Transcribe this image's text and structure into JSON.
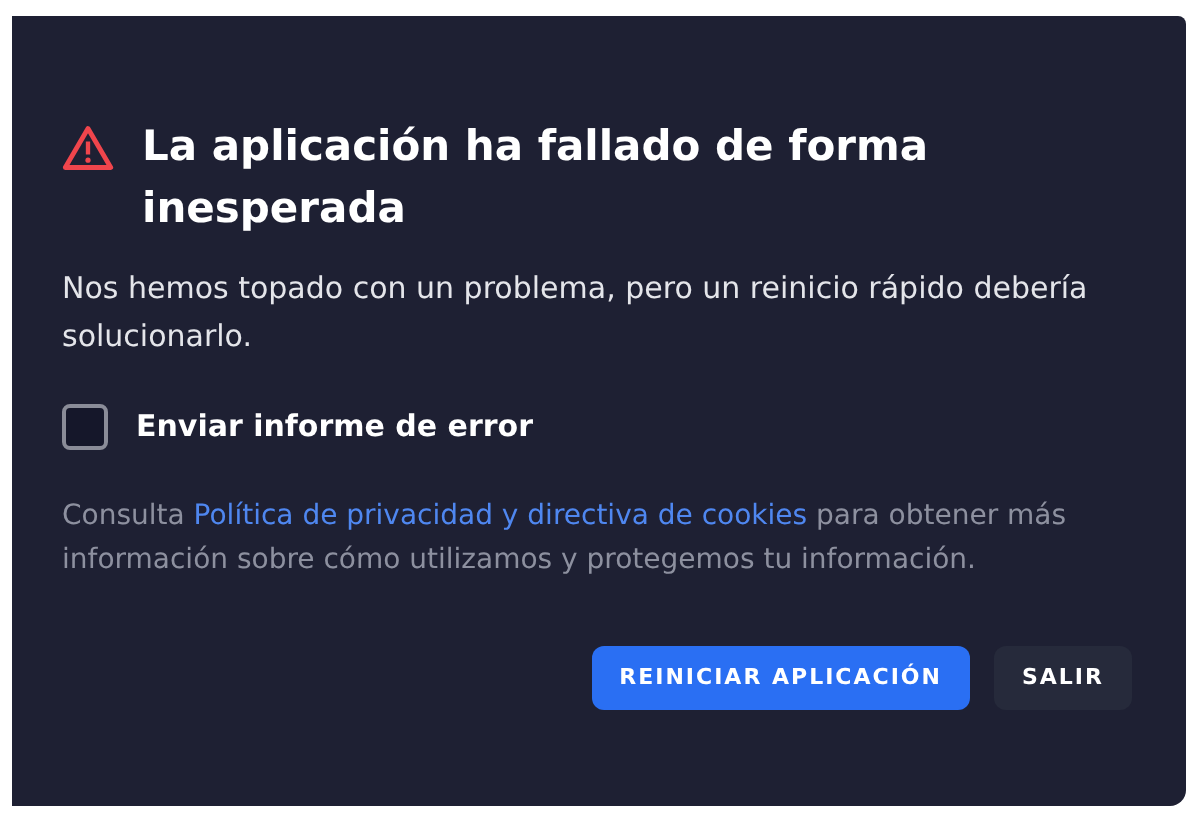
{
  "dialog": {
    "title": "La aplicación ha fallado de forma inesperada",
    "message": "Nos hemos topado con un problema, pero un reinicio rápido debería solucionarlo.",
    "checkbox": {
      "label": "Enviar informe de error",
      "checked": false
    },
    "info": {
      "before": "Consulta ",
      "link": "Política de privacidad y directiva de cookies",
      "after": " para obtener más información sobre cómo utilizamos y protegemos tu información."
    },
    "buttons": [
      {
        "label": "REINICIAR APLICACIÓN",
        "kind": "primary"
      },
      {
        "label": "SALIR",
        "kind": "secondary"
      }
    ]
  }
}
